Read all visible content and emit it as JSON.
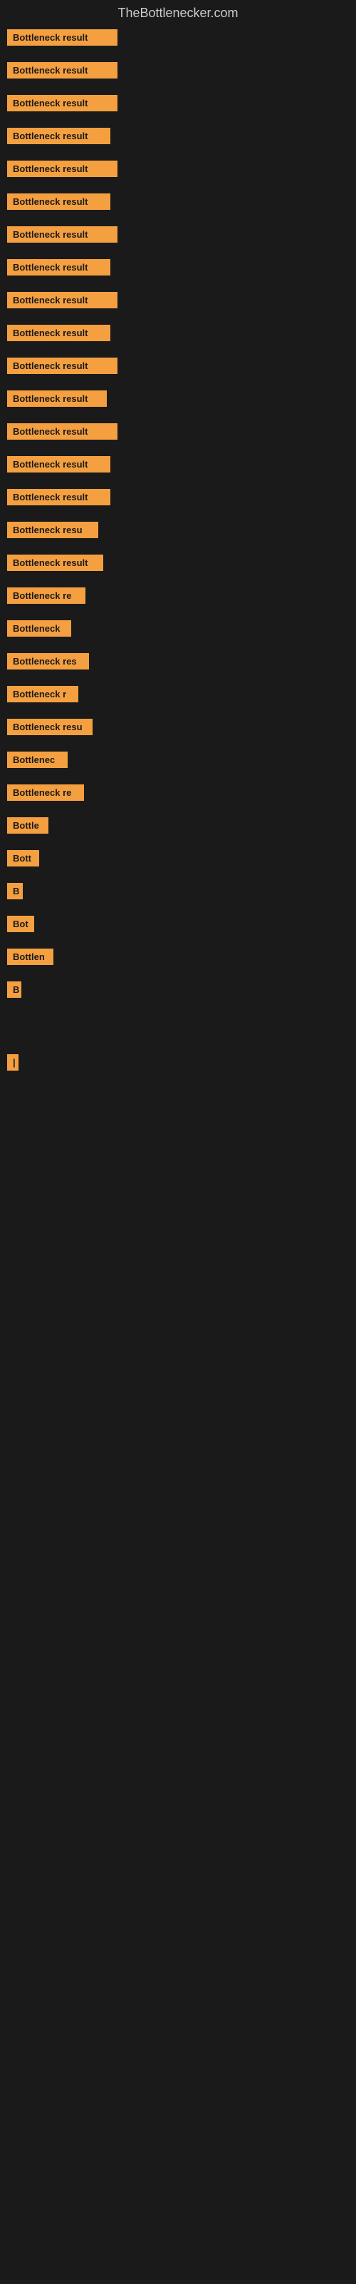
{
  "site": {
    "title": "TheBottlenecker.com"
  },
  "items": [
    {
      "label": "Bottleneck result",
      "width": 155
    },
    {
      "label": "Bottleneck result",
      "width": 155
    },
    {
      "label": "Bottleneck result",
      "width": 155
    },
    {
      "label": "Bottleneck result",
      "width": 145
    },
    {
      "label": "Bottleneck result",
      "width": 155
    },
    {
      "label": "Bottleneck result",
      "width": 145
    },
    {
      "label": "Bottleneck result",
      "width": 155
    },
    {
      "label": "Bottleneck result",
      "width": 145
    },
    {
      "label": "Bottleneck result",
      "width": 155
    },
    {
      "label": "Bottleneck result",
      "width": 145
    },
    {
      "label": "Bottleneck result",
      "width": 155
    },
    {
      "label": "Bottleneck result",
      "width": 140
    },
    {
      "label": "Bottleneck result",
      "width": 155
    },
    {
      "label": "Bottleneck result",
      "width": 145
    },
    {
      "label": "Bottleneck result",
      "width": 145
    },
    {
      "label": "Bottleneck resu",
      "width": 128
    },
    {
      "label": "Bottleneck result",
      "width": 135
    },
    {
      "label": "Bottleneck re",
      "width": 110
    },
    {
      "label": "Bottleneck",
      "width": 90
    },
    {
      "label": "Bottleneck res",
      "width": 115
    },
    {
      "label": "Bottleneck r",
      "width": 100
    },
    {
      "label": "Bottleneck resu",
      "width": 120
    },
    {
      "label": "Bottlenec",
      "width": 85
    },
    {
      "label": "Bottleneck re",
      "width": 108
    },
    {
      "label": "Bottle",
      "width": 58
    },
    {
      "label": "Bott",
      "width": 45
    },
    {
      "label": "B",
      "width": 22
    },
    {
      "label": "Bot",
      "width": 38
    },
    {
      "label": "Bottlen",
      "width": 65
    },
    {
      "label": "B",
      "width": 20
    },
    {
      "label": "",
      "width": 10
    },
    {
      "label": "",
      "width": 0
    },
    {
      "label": "|",
      "width": 10
    },
    {
      "label": "",
      "width": 0
    },
    {
      "label": "",
      "width": 0
    },
    {
      "label": "",
      "width": 0
    },
    {
      "label": "",
      "width": 8
    }
  ]
}
